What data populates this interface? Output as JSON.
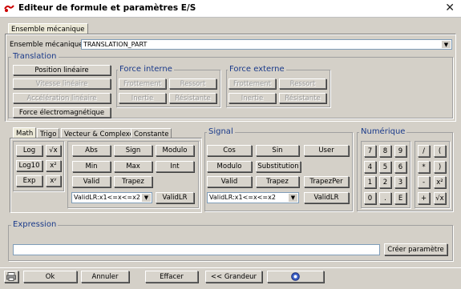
{
  "window": {
    "title": "Editeur de formule et paramètres E/S",
    "close": "✕"
  },
  "top_tab": "Ensemble mécanique",
  "ensemble": {
    "label": "Ensemble mécanique :",
    "value": "TRANSLATION_PART"
  },
  "translation": {
    "title": "Translation",
    "position": "Position linéaire",
    "vitesse": "Vitesse linéaire",
    "acceleration": "Accélération linéaire",
    "force_em": "Force électromagnétique"
  },
  "force_interne": {
    "title": "Force interne",
    "frottement": "Frottement",
    "ressort": "Ressort",
    "inertie": "Inertie",
    "resistante": "Résistante"
  },
  "force_externe": {
    "title": "Force externe",
    "frottement": "Frottement",
    "ressort": "Ressort",
    "inertie": "Inertie",
    "resistante": "Résistante"
  },
  "math_tabs": [
    "Math",
    "Trigo",
    "Vecteur & Complexe",
    "Constante"
  ],
  "math": {
    "log": "Log",
    "sqrt": "√x",
    "log10": "Log10",
    "x2": "x²",
    "exp": "Exp",
    "xy": "xʸ",
    "abs": "Abs",
    "sign": "Sign",
    "modulo": "Modulo",
    "min": "Min",
    "max": "Max",
    "int": "Int",
    "valid": "Valid",
    "trapez": "Trapez",
    "combo": "ValidLR:x1<=x<=x2",
    "validlr": "ValidLR"
  },
  "signal": {
    "title": "Signal",
    "cos": "Cos",
    "sin": "Sin",
    "user": "User",
    "modulo": "Modulo",
    "substitution": "Substitution",
    "valid": "Valid",
    "trapez": "Trapez",
    "trapezper": "TrapezPer",
    "combo": "ValidLR:x1<=x<=x2",
    "validlr": "ValidLR"
  },
  "numerique": {
    "title": "Numérique",
    "keys": [
      "7",
      "8",
      "9",
      "4",
      "5",
      "6",
      "1",
      "2",
      "3",
      "0",
      ".",
      "E"
    ],
    "ops": [
      "/",
      "(",
      "*",
      ")",
      "-",
      "x²",
      "+",
      "√x"
    ]
  },
  "expression": {
    "title": "Expression",
    "value": "",
    "create": "Créer paramètre"
  },
  "footer": {
    "ok": "Ok",
    "annuler": "Annuler",
    "effacer": "Effacer",
    "grandeur": "<< Grandeur"
  }
}
